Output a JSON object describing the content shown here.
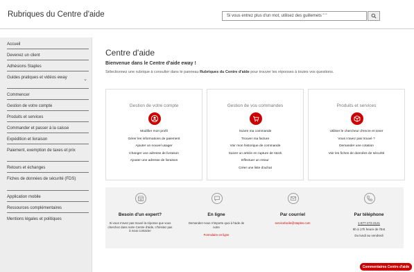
{
  "header": {
    "brand": "Rubriques du Centre d'aide",
    "search_value": "Si vous entrez plus d'un mot, utilisez des guillemets \" \""
  },
  "sidebar": {
    "items": [
      {
        "label": "Accueil"
      },
      {
        "label": "Devenez un client"
      },
      {
        "label": "Adhésions Staples"
      },
      {
        "label": "Guides pratiques et vidéos eway"
      },
      {
        "label": "Commencer"
      },
      {
        "label": "Gestion de votre compte"
      },
      {
        "label": "Produits et services"
      },
      {
        "label": "Commander et passer à la caisse"
      },
      {
        "label": "Expédition et livraison"
      },
      {
        "label": "Paiement, exemption de taxes et prix"
      },
      {
        "label": "Retours et échanges"
      },
      {
        "label": "Fiches de données de sécurité (FDS)"
      },
      {
        "label": "Application mobile"
      },
      {
        "label": "Ressources complémentaires"
      },
      {
        "label": "Mentions légales et politiques"
      }
    ]
  },
  "main": {
    "title": "Centre d'aide",
    "subtitle": "Bienvenue dans le Centre d'aide eway !",
    "desc_before": "Sélectionnez une rubrique à consulter dans le panneau ",
    "desc_bold": "Rubriques du Centre d'aide",
    "desc_after": " pour trouver les réponses à toutes vos questions."
  },
  "cards": [
    {
      "title": "Gestion de votre compte",
      "icon": "user-icon",
      "links": [
        "Modifier mon profil",
        "Gérer les informations de paiement",
        "Ajouter un nouvel usager",
        "Changer une adresse de livraison",
        "Ajouter une adresse de livraison"
      ]
    },
    {
      "title": "Gestion de vos commandes",
      "icon": "cart-icon",
      "links": [
        "Suivre ma commande",
        "Trouver ma facture",
        "Voir mon historique de commande",
        "Suivre un article en rupture de stock",
        "Effectuer un retour",
        "Créer une liste d'achat"
      ]
    },
    {
      "title": "Produits et services",
      "icon": "box-icon",
      "links": [
        "Utiliser le chercheur d'encre et toner",
        "Vous n'avez pas trouvé ?",
        "Demander une cotation",
        "Voir les fiches de données de sécurité"
      ]
    }
  ],
  "support": {
    "expert": {
      "title": "Besoin d'un expert?",
      "text": "Si vous n'avez pas trouvé la réponse que vous cherchez dans notre Centre d'aide, n'hésitez pas à nous contacter"
    },
    "online": {
      "title": "En ligne",
      "text": "Demandez-nous n'importe quoi à l'aide de notre",
      "link": "Formulaire en ligne"
    },
    "email": {
      "title": "Par courriel",
      "link": "servicefacile@staples.com"
    },
    "phone": {
      "title": "Par téléphone",
      "number": "1-877-272-2121",
      "hours": "8h à 17h heure de l'Est",
      "days": "Du lundi au vendredi"
    }
  },
  "feedback_label": "Commentaires Centre d'aide",
  "colors": {
    "accent": "#cc0000",
    "sidebar_bg": "#ededed",
    "support_bg": "#f2f2f2"
  }
}
